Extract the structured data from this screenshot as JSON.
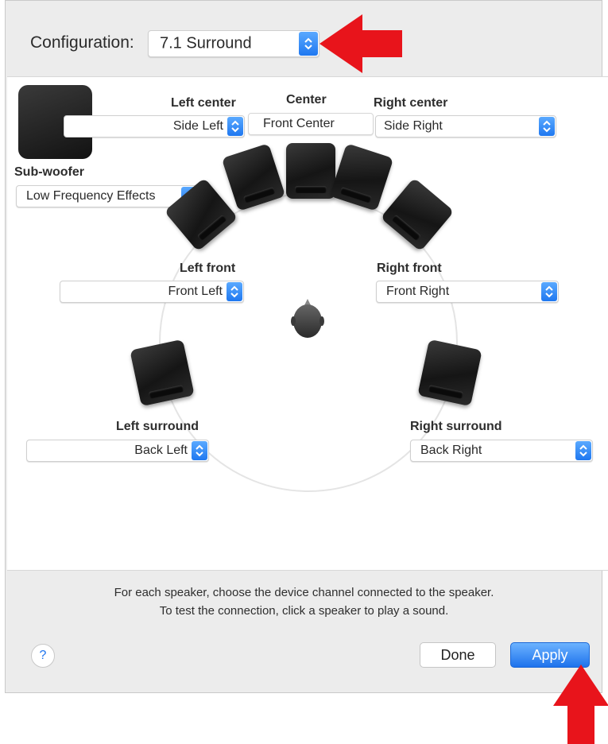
{
  "header": {
    "configuration_label": "Configuration:",
    "configuration_value": "7.1 Surround"
  },
  "speakers": {
    "center": {
      "label": "Center",
      "channel": "Front Center"
    },
    "left_center": {
      "label": "Left center",
      "channel": "Side Left"
    },
    "right_center": {
      "label": "Right center",
      "channel": "Side Right"
    },
    "subwoofer": {
      "label": "Sub-woofer",
      "channel": "Low Frequency Effects"
    },
    "left_front": {
      "label": "Left front",
      "channel": "Front Left"
    },
    "right_front": {
      "label": "Right front",
      "channel": "Front Right"
    },
    "left_surround": {
      "label": "Left surround",
      "channel": "Back Left"
    },
    "right_surround": {
      "label": "Right surround",
      "channel": "Back Right"
    }
  },
  "footer": {
    "instruction_line1": "For each speaker, choose the device channel connected to the speaker.",
    "instruction_line2": "To test the connection, click a speaker to play a sound.",
    "help_label": "?",
    "done_label": "Done",
    "apply_label": "Apply"
  },
  "colors": {
    "accent_blue": "#1e72ec",
    "annotation_red": "#e8141b"
  },
  "icons": [
    "up-down-stepper-icon",
    "speaker-icon",
    "listener-head-icon",
    "help-icon",
    "red-arrow-icon"
  ]
}
